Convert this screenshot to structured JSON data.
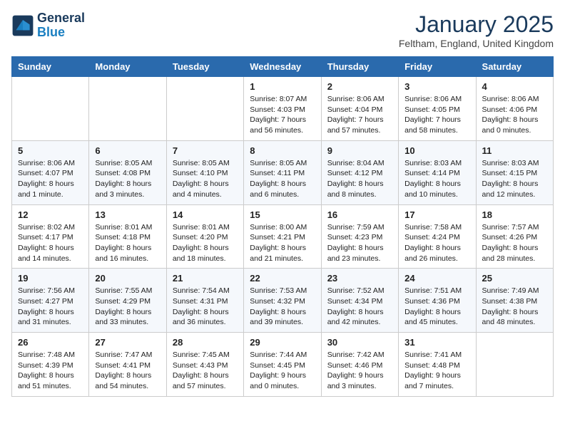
{
  "header": {
    "logo_general": "General",
    "logo_blue": "Blue",
    "month": "January 2025",
    "location": "Feltham, England, United Kingdom"
  },
  "days_of_week": [
    "Sunday",
    "Monday",
    "Tuesday",
    "Wednesday",
    "Thursday",
    "Friday",
    "Saturday"
  ],
  "weeks": [
    [
      {
        "day": "",
        "info": ""
      },
      {
        "day": "",
        "info": ""
      },
      {
        "day": "",
        "info": ""
      },
      {
        "day": "1",
        "info": "Sunrise: 8:07 AM\nSunset: 4:03 PM\nDaylight: 7 hours and 56 minutes."
      },
      {
        "day": "2",
        "info": "Sunrise: 8:06 AM\nSunset: 4:04 PM\nDaylight: 7 hours and 57 minutes."
      },
      {
        "day": "3",
        "info": "Sunrise: 8:06 AM\nSunset: 4:05 PM\nDaylight: 7 hours and 58 minutes."
      },
      {
        "day": "4",
        "info": "Sunrise: 8:06 AM\nSunset: 4:06 PM\nDaylight: 8 hours and 0 minutes."
      }
    ],
    [
      {
        "day": "5",
        "info": "Sunrise: 8:06 AM\nSunset: 4:07 PM\nDaylight: 8 hours and 1 minute."
      },
      {
        "day": "6",
        "info": "Sunrise: 8:05 AM\nSunset: 4:08 PM\nDaylight: 8 hours and 3 minutes."
      },
      {
        "day": "7",
        "info": "Sunrise: 8:05 AM\nSunset: 4:10 PM\nDaylight: 8 hours and 4 minutes."
      },
      {
        "day": "8",
        "info": "Sunrise: 8:05 AM\nSunset: 4:11 PM\nDaylight: 8 hours and 6 minutes."
      },
      {
        "day": "9",
        "info": "Sunrise: 8:04 AM\nSunset: 4:12 PM\nDaylight: 8 hours and 8 minutes."
      },
      {
        "day": "10",
        "info": "Sunrise: 8:03 AM\nSunset: 4:14 PM\nDaylight: 8 hours and 10 minutes."
      },
      {
        "day": "11",
        "info": "Sunrise: 8:03 AM\nSunset: 4:15 PM\nDaylight: 8 hours and 12 minutes."
      }
    ],
    [
      {
        "day": "12",
        "info": "Sunrise: 8:02 AM\nSunset: 4:17 PM\nDaylight: 8 hours and 14 minutes."
      },
      {
        "day": "13",
        "info": "Sunrise: 8:01 AM\nSunset: 4:18 PM\nDaylight: 8 hours and 16 minutes."
      },
      {
        "day": "14",
        "info": "Sunrise: 8:01 AM\nSunset: 4:20 PM\nDaylight: 8 hours and 18 minutes."
      },
      {
        "day": "15",
        "info": "Sunrise: 8:00 AM\nSunset: 4:21 PM\nDaylight: 8 hours and 21 minutes."
      },
      {
        "day": "16",
        "info": "Sunrise: 7:59 AM\nSunset: 4:23 PM\nDaylight: 8 hours and 23 minutes."
      },
      {
        "day": "17",
        "info": "Sunrise: 7:58 AM\nSunset: 4:24 PM\nDaylight: 8 hours and 26 minutes."
      },
      {
        "day": "18",
        "info": "Sunrise: 7:57 AM\nSunset: 4:26 PM\nDaylight: 8 hours and 28 minutes."
      }
    ],
    [
      {
        "day": "19",
        "info": "Sunrise: 7:56 AM\nSunset: 4:27 PM\nDaylight: 8 hours and 31 minutes."
      },
      {
        "day": "20",
        "info": "Sunrise: 7:55 AM\nSunset: 4:29 PM\nDaylight: 8 hours and 33 minutes."
      },
      {
        "day": "21",
        "info": "Sunrise: 7:54 AM\nSunset: 4:31 PM\nDaylight: 8 hours and 36 minutes."
      },
      {
        "day": "22",
        "info": "Sunrise: 7:53 AM\nSunset: 4:32 PM\nDaylight: 8 hours and 39 minutes."
      },
      {
        "day": "23",
        "info": "Sunrise: 7:52 AM\nSunset: 4:34 PM\nDaylight: 8 hours and 42 minutes."
      },
      {
        "day": "24",
        "info": "Sunrise: 7:51 AM\nSunset: 4:36 PM\nDaylight: 8 hours and 45 minutes."
      },
      {
        "day": "25",
        "info": "Sunrise: 7:49 AM\nSunset: 4:38 PM\nDaylight: 8 hours and 48 minutes."
      }
    ],
    [
      {
        "day": "26",
        "info": "Sunrise: 7:48 AM\nSunset: 4:39 PM\nDaylight: 8 hours and 51 minutes."
      },
      {
        "day": "27",
        "info": "Sunrise: 7:47 AM\nSunset: 4:41 PM\nDaylight: 8 hours and 54 minutes."
      },
      {
        "day": "28",
        "info": "Sunrise: 7:45 AM\nSunset: 4:43 PM\nDaylight: 8 hours and 57 minutes."
      },
      {
        "day": "29",
        "info": "Sunrise: 7:44 AM\nSunset: 4:45 PM\nDaylight: 9 hours and 0 minutes."
      },
      {
        "day": "30",
        "info": "Sunrise: 7:42 AM\nSunset: 4:46 PM\nDaylight: 9 hours and 3 minutes."
      },
      {
        "day": "31",
        "info": "Sunrise: 7:41 AM\nSunset: 4:48 PM\nDaylight: 9 hours and 7 minutes."
      },
      {
        "day": "",
        "info": ""
      }
    ]
  ]
}
